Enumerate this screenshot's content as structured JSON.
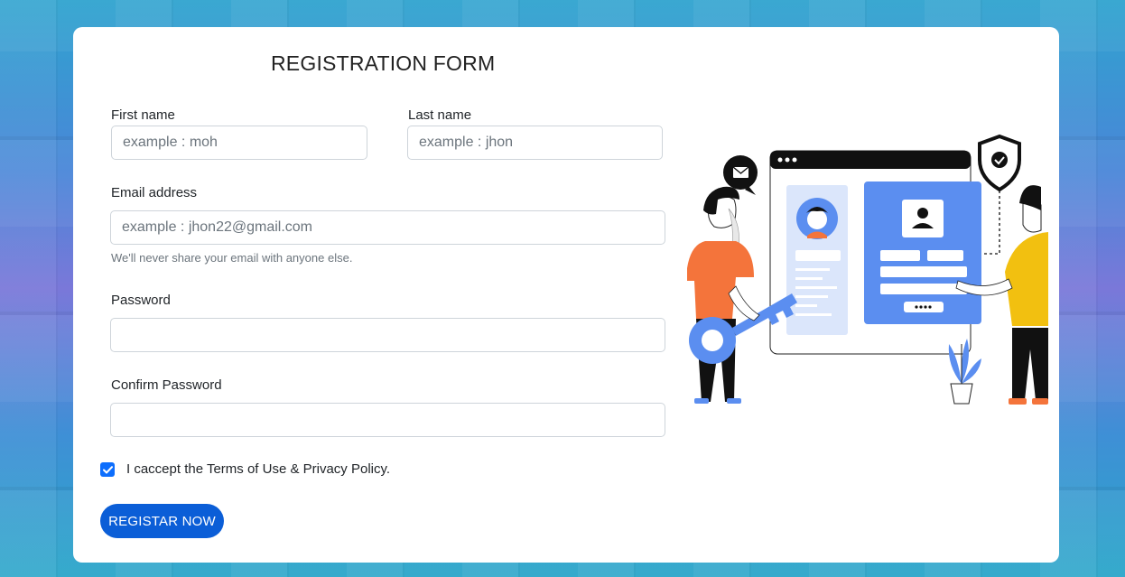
{
  "form": {
    "title": "REGISTRATION FORM",
    "first_name": {
      "label": "First name",
      "placeholder": "example : moh"
    },
    "last_name": {
      "label": "Last name",
      "placeholder": "example : jhon"
    },
    "email": {
      "label": "Email address",
      "placeholder": "example : jhon22@gmail.com",
      "help": "We'll never share your email with anyone else."
    },
    "password": {
      "label": "Password",
      "placeholder": ""
    },
    "confirm_password": {
      "label": "Confirm Password",
      "placeholder": ""
    },
    "terms": {
      "label": "I caccept the Terms of Use & Privacy Policy.",
      "checked": true
    },
    "submit_label": "REGISTAR NOW"
  },
  "colors": {
    "primary": "#0b5ed7",
    "checkbox": "#0d6efd",
    "illustration_blue": "#5b8ef0",
    "illustration_orange": "#f4743b",
    "illustration_yellow": "#f2c010"
  },
  "illustration": {
    "icons": [
      "mail-icon",
      "shield-check-icon",
      "user-icon",
      "key-icon",
      "plant-icon"
    ]
  }
}
